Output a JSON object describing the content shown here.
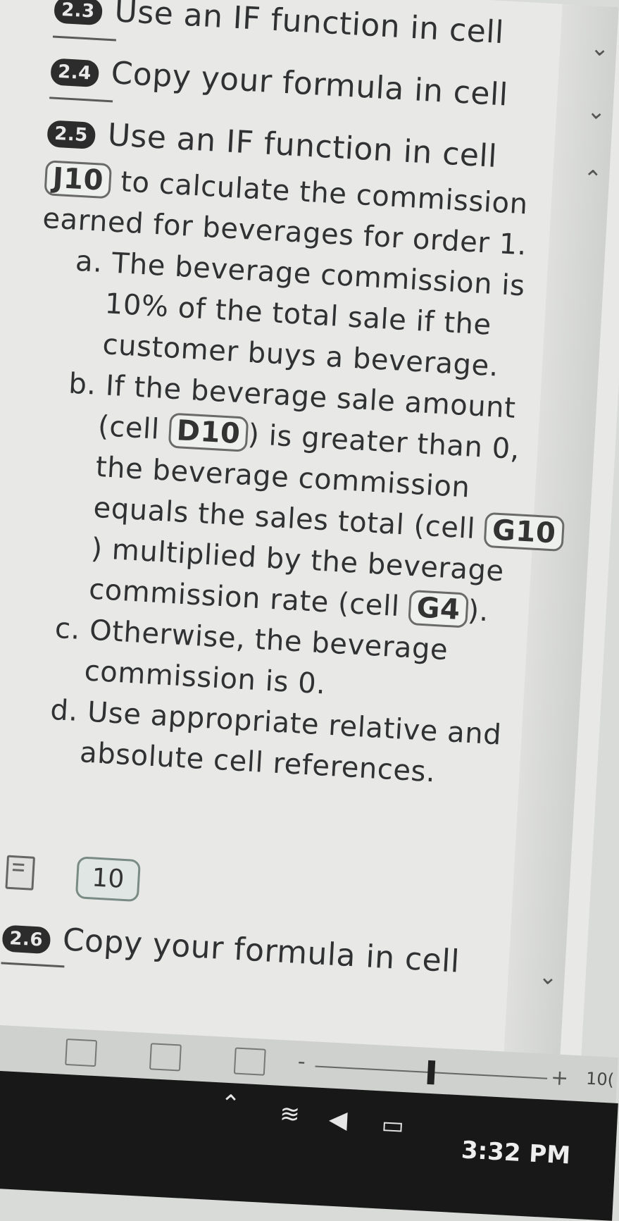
{
  "tasks": [
    {
      "badge": "2.3",
      "title": "Use an IF function in cell"
    },
    {
      "badge": "2.4",
      "title": "Copy your formula in cell"
    },
    {
      "badge": "2.5",
      "title": "Use an IF function in cell"
    },
    {
      "badge": "2.6",
      "title": "Copy your formula in cell"
    }
  ],
  "expanded": {
    "intro_ref": "J10",
    "intro_line1": "to calculate the commission",
    "intro_line2": "earned for beverages for order 1.",
    "a_line1": "a. The beverage commission is",
    "a_line2": "10% of the total sale if the",
    "a_line3": "customer buys a beverage.",
    "b_line1": "b. If the beverage sale amount",
    "b_pre": "(cell",
    "b_ref1": "D10",
    "b_post": ") is greater than 0,",
    "b_line3": "the beverage commission",
    "b_line4_pre": "equals the sales total (cell",
    "b_ref2": "G10",
    "b_line5": ") multiplied by the beverage",
    "b_line6_pre": "commission rate (cell",
    "b_ref3": "G4",
    "b_line6_post": ").",
    "c_line1": "c. Otherwise, the beverage",
    "c_line2": "commission is 0.",
    "d_line1": "d. Use appropriate relative and",
    "d_line2": "absolute cell references.",
    "answer_value": "10"
  },
  "statusbar": {
    "zoom_plus": "+",
    "zoom_minus": "-",
    "zoom_percent": "10("
  },
  "taskbar": {
    "time": "3:32 PM"
  }
}
